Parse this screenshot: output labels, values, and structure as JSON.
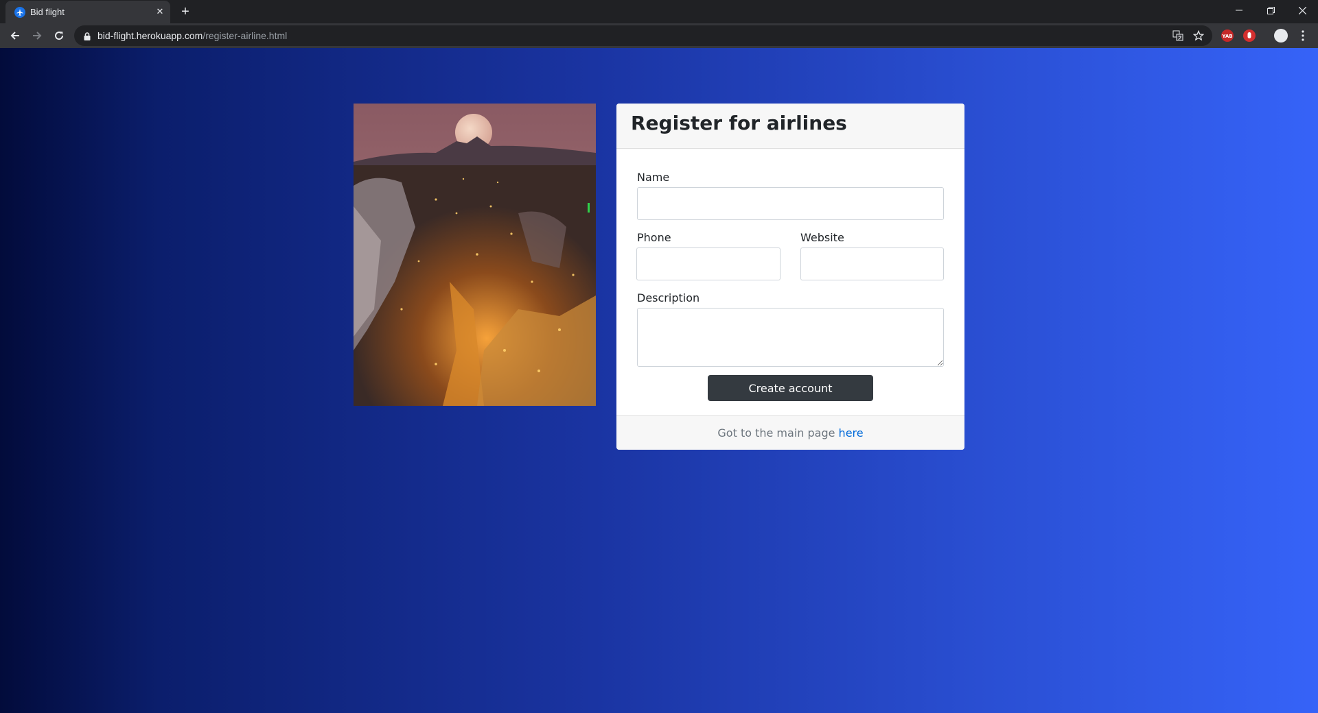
{
  "browser": {
    "tab_title": "Bid flight",
    "tab_close_glyph": "✕",
    "new_tab_glyph": "+",
    "url_host": "bid-flight.herokuapp.com",
    "url_path": "/register-airline.html",
    "extension_badge": "YAB",
    "icons": [
      "back-icon",
      "forward-icon",
      "reload-icon",
      "lock-icon",
      "translate-icon",
      "star-icon",
      "minimize-icon",
      "restore-icon",
      "close-window-icon",
      "more-menu-icon"
    ]
  },
  "page": {
    "photo_description_hint": "",
    "card": {
      "title": "Register for airlines",
      "fields": {
        "name_label": "Name",
        "name_value": "",
        "phone_label": "Phone",
        "phone_value": "",
        "website_label": "Website",
        "website_value": "",
        "description_label": "Description",
        "description_value": ""
      },
      "submit_label": "Create account",
      "footer_text": "Got to the main page ",
      "footer_link": "here"
    }
  },
  "colors": {
    "gradient_left": "#020b3b",
    "gradient_right": "#3663f8",
    "button": "#343a40",
    "link": "#0069d9"
  }
}
